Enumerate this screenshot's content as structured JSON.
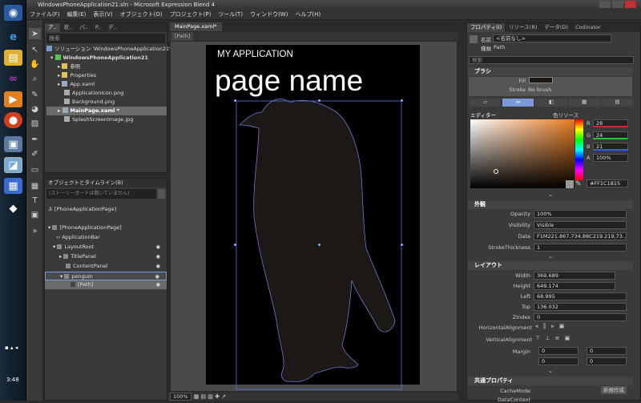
{
  "window": {
    "title": "WindowsPhoneApplication21.sln - Microsoft Expression Blend 4"
  },
  "menu": [
    "ファイル(F)",
    "編集(E)",
    "表示(V)",
    "オブジェクト(O)",
    "プロジェクト(P)",
    "ツール(T)",
    "ウィンドウ(W)",
    "ヘルプ(H)"
  ],
  "taskbar": {
    "clock": "3:48"
  },
  "project_panel": {
    "tabs": [
      "ア..",
      "状..",
      "パ..",
      "P..",
      "デ.."
    ],
    "search_placeholder": "検索",
    "items": [
      "ソリューション 'WindowsPhoneApplication21'",
      "WindowsPhoneApplication21",
      "参照",
      "Properties",
      "App.xaml",
      "ApplicationIcon.png",
      "Background.png",
      "MainPage.xaml *",
      "SplashScreenImage.jpg"
    ]
  },
  "objects_panel": {
    "title": "オブジェクトとタイムライン(B)",
    "storyboard": "(ストーリーボードは開いていません)",
    "items": [
      "[PhoneApplicationPage]",
      "[PhoneApplicationPage]",
      "ApplicationBar",
      "LayoutRoot",
      "TitlePanel",
      "ContentPanel",
      "penguin",
      "[Path]"
    ]
  },
  "document": {
    "tab": "MainPage.xaml*",
    "breadcrumb": "[Path]",
    "app_name": "MY APPLICATION",
    "page_name": "page name",
    "zoom": "100%"
  },
  "properties": {
    "tabs": [
      "プロパティ(I)",
      "リソース(R)",
      "データ(D)",
      "Codinator"
    ],
    "name_label": "名前",
    "name_value": "<名前なし>",
    "type_label": "種類",
    "type_value": "Path",
    "search_placeholder": "検索",
    "brush_header": "ブラシ",
    "fill_label": "Fill",
    "stroke_label": "Stroke",
    "stroke_value": "No brush",
    "editor_label": "エディター",
    "color_resources": "色リソース",
    "r": "28",
    "g": "24",
    "b": "21",
    "a": "100%",
    "hex": "#FF1C1815",
    "appearance_header": "外観",
    "opacity_label": "Opacity",
    "opacity": "100%",
    "visibility_label": "Visibility",
    "visibility": "Visible",
    "data_label": "Data",
    "data_value": "F1M221.867,734.88C219.219,73...",
    "stroke_thickness_label": "StrokeThickness",
    "stroke_thickness": "1",
    "layout_header": "レイアウト",
    "width_label": "Width",
    "width": "369.689",
    "height_label": "Height",
    "height": "649.174",
    "left_label": "Left",
    "left": "68.995",
    "top_label": "Top",
    "top": "136.032",
    "zindex_label": "ZIndex",
    "zindex": "0",
    "halign_label": "HorizontalAlignment",
    "valign_label": "VerticalAlignment",
    "margin_label": "Margin",
    "margin_values": [
      "0",
      "0",
      "0",
      "0"
    ],
    "common_header": "共通プロパティ",
    "cachemode_label": "CacheMode",
    "new_button": "新規作成",
    "datacontext_label": "DataContext"
  },
  "colors": {
    "fill": "#1C1815",
    "accent": "#5a7ad8"
  }
}
